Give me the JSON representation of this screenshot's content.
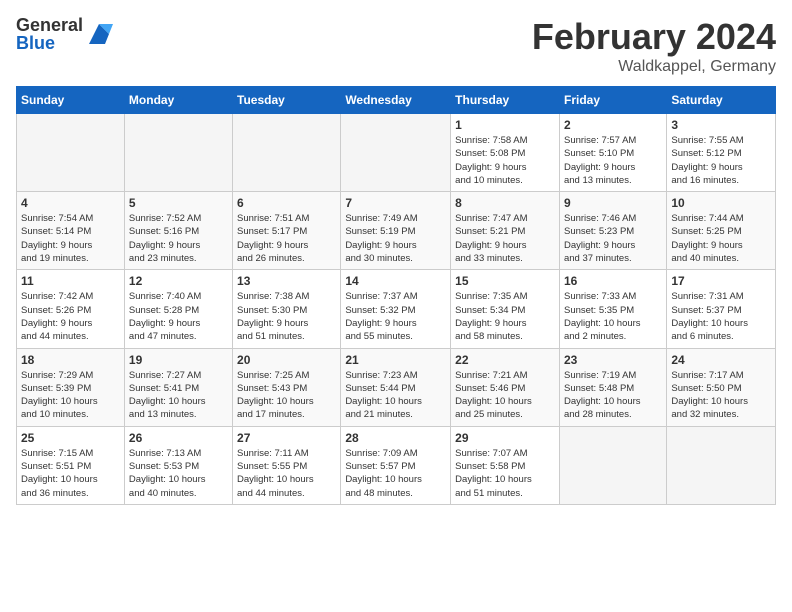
{
  "header": {
    "logo_general": "General",
    "logo_blue": "Blue",
    "month_title": "February 2024",
    "location": "Waldkappel, Germany"
  },
  "calendar": {
    "days_of_week": [
      "Sunday",
      "Monday",
      "Tuesday",
      "Wednesday",
      "Thursday",
      "Friday",
      "Saturday"
    ],
    "weeks": [
      [
        {
          "day": "",
          "info": ""
        },
        {
          "day": "",
          "info": ""
        },
        {
          "day": "",
          "info": ""
        },
        {
          "day": "",
          "info": ""
        },
        {
          "day": "1",
          "info": "Sunrise: 7:58 AM\nSunset: 5:08 PM\nDaylight: 9 hours\nand 10 minutes."
        },
        {
          "day": "2",
          "info": "Sunrise: 7:57 AM\nSunset: 5:10 PM\nDaylight: 9 hours\nand 13 minutes."
        },
        {
          "day": "3",
          "info": "Sunrise: 7:55 AM\nSunset: 5:12 PM\nDaylight: 9 hours\nand 16 minutes."
        }
      ],
      [
        {
          "day": "4",
          "info": "Sunrise: 7:54 AM\nSunset: 5:14 PM\nDaylight: 9 hours\nand 19 minutes."
        },
        {
          "day": "5",
          "info": "Sunrise: 7:52 AM\nSunset: 5:16 PM\nDaylight: 9 hours\nand 23 minutes."
        },
        {
          "day": "6",
          "info": "Sunrise: 7:51 AM\nSunset: 5:17 PM\nDaylight: 9 hours\nand 26 minutes."
        },
        {
          "day": "7",
          "info": "Sunrise: 7:49 AM\nSunset: 5:19 PM\nDaylight: 9 hours\nand 30 minutes."
        },
        {
          "day": "8",
          "info": "Sunrise: 7:47 AM\nSunset: 5:21 PM\nDaylight: 9 hours\nand 33 minutes."
        },
        {
          "day": "9",
          "info": "Sunrise: 7:46 AM\nSunset: 5:23 PM\nDaylight: 9 hours\nand 37 minutes."
        },
        {
          "day": "10",
          "info": "Sunrise: 7:44 AM\nSunset: 5:25 PM\nDaylight: 9 hours\nand 40 minutes."
        }
      ],
      [
        {
          "day": "11",
          "info": "Sunrise: 7:42 AM\nSunset: 5:26 PM\nDaylight: 9 hours\nand 44 minutes."
        },
        {
          "day": "12",
          "info": "Sunrise: 7:40 AM\nSunset: 5:28 PM\nDaylight: 9 hours\nand 47 minutes."
        },
        {
          "day": "13",
          "info": "Sunrise: 7:38 AM\nSunset: 5:30 PM\nDaylight: 9 hours\nand 51 minutes."
        },
        {
          "day": "14",
          "info": "Sunrise: 7:37 AM\nSunset: 5:32 PM\nDaylight: 9 hours\nand 55 minutes."
        },
        {
          "day": "15",
          "info": "Sunrise: 7:35 AM\nSunset: 5:34 PM\nDaylight: 9 hours\nand 58 minutes."
        },
        {
          "day": "16",
          "info": "Sunrise: 7:33 AM\nSunset: 5:35 PM\nDaylight: 10 hours\nand 2 minutes."
        },
        {
          "day": "17",
          "info": "Sunrise: 7:31 AM\nSunset: 5:37 PM\nDaylight: 10 hours\nand 6 minutes."
        }
      ],
      [
        {
          "day": "18",
          "info": "Sunrise: 7:29 AM\nSunset: 5:39 PM\nDaylight: 10 hours\nand 10 minutes."
        },
        {
          "day": "19",
          "info": "Sunrise: 7:27 AM\nSunset: 5:41 PM\nDaylight: 10 hours\nand 13 minutes."
        },
        {
          "day": "20",
          "info": "Sunrise: 7:25 AM\nSunset: 5:43 PM\nDaylight: 10 hours\nand 17 minutes."
        },
        {
          "day": "21",
          "info": "Sunrise: 7:23 AM\nSunset: 5:44 PM\nDaylight: 10 hours\nand 21 minutes."
        },
        {
          "day": "22",
          "info": "Sunrise: 7:21 AM\nSunset: 5:46 PM\nDaylight: 10 hours\nand 25 minutes."
        },
        {
          "day": "23",
          "info": "Sunrise: 7:19 AM\nSunset: 5:48 PM\nDaylight: 10 hours\nand 28 minutes."
        },
        {
          "day": "24",
          "info": "Sunrise: 7:17 AM\nSunset: 5:50 PM\nDaylight: 10 hours\nand 32 minutes."
        }
      ],
      [
        {
          "day": "25",
          "info": "Sunrise: 7:15 AM\nSunset: 5:51 PM\nDaylight: 10 hours\nand 36 minutes."
        },
        {
          "day": "26",
          "info": "Sunrise: 7:13 AM\nSunset: 5:53 PM\nDaylight: 10 hours\nand 40 minutes."
        },
        {
          "day": "27",
          "info": "Sunrise: 7:11 AM\nSunset: 5:55 PM\nDaylight: 10 hours\nand 44 minutes."
        },
        {
          "day": "28",
          "info": "Sunrise: 7:09 AM\nSunset: 5:57 PM\nDaylight: 10 hours\nand 48 minutes."
        },
        {
          "day": "29",
          "info": "Sunrise: 7:07 AM\nSunset: 5:58 PM\nDaylight: 10 hours\nand 51 minutes."
        },
        {
          "day": "",
          "info": ""
        },
        {
          "day": "",
          "info": ""
        }
      ]
    ]
  }
}
